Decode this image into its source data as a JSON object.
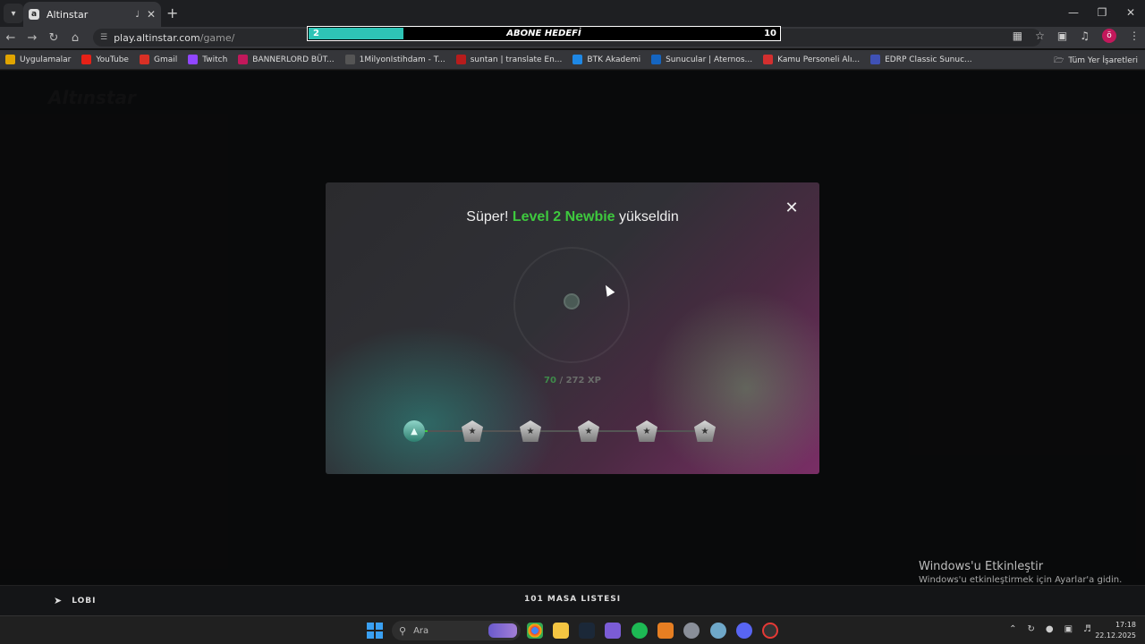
{
  "browser": {
    "tab_title": "Altinstar",
    "url_host": "play.altinstar.com",
    "url_path": "/game/",
    "bookmarks": [
      {
        "label": "Uygulamalar",
        "color": "#e0a400"
      },
      {
        "label": "YouTube",
        "color": "#e62117"
      },
      {
        "label": "Gmail",
        "color": "#d93025"
      },
      {
        "label": "Twitch",
        "color": "#9146ff"
      },
      {
        "label": "BANNERLORD BÜT...",
        "color": "#c2185b"
      },
      {
        "label": "1MilyonIstihdam - T...",
        "color": "#555555"
      },
      {
        "label": "suntan | translate En...",
        "color": "#b71c1c"
      },
      {
        "label": "BTK Akademi",
        "color": "#1e88e5"
      },
      {
        "label": "Sunucular | Aternos...",
        "color": "#1565c0"
      },
      {
        "label": "Kamu Personeli Alı...",
        "color": "#d32f2f"
      },
      {
        "label": "EDRP Classic Sunuc...",
        "color": "#3f51b5"
      }
    ],
    "all_bookmarks": "Tüm Yer İşaretleri",
    "profile_initial": "ö"
  },
  "goal_bar": {
    "current": "2",
    "label": "ABONE HEDEFİ",
    "max": "10",
    "progress": 0.2,
    "fill_color": "#2ec4b6"
  },
  "modal": {
    "headline_prefix": "Süper!",
    "headline_level": "Level 2 Newbie",
    "headline_suffix": "yükseldin",
    "level_color": "#3ec93e",
    "xp_current": "70",
    "xp_rest": "/ 272 XP",
    "ranks": [
      {
        "name": "rank-newbie",
        "active": true
      },
      {
        "name": "rank-2",
        "active": false
      },
      {
        "name": "rank-3",
        "active": false
      },
      {
        "name": "rank-4",
        "active": false
      },
      {
        "name": "rank-5",
        "active": false
      },
      {
        "name": "rank-6",
        "active": false
      }
    ]
  },
  "bottom": {
    "lobi": "LOBI",
    "masa": "101 MASA LISTESI"
  },
  "watermark": {
    "line1": "Windows'u Etkinleştir",
    "line2": "Windows'u etkinleştirmek için Ayarlar'a gidin."
  },
  "taskbar": {
    "search_placeholder": "Ara",
    "time": "17:18",
    "date": "22.12.2025"
  }
}
